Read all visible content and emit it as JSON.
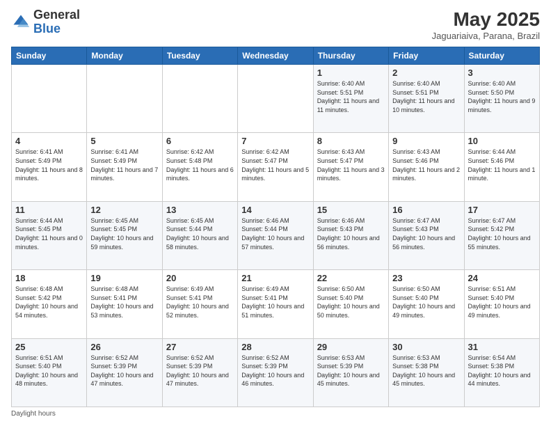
{
  "header": {
    "logo_general": "General",
    "logo_blue": "Blue",
    "month_title": "May 2025",
    "subtitle": "Jaguariaiva, Parana, Brazil"
  },
  "days_of_week": [
    "Sunday",
    "Monday",
    "Tuesday",
    "Wednesday",
    "Thursday",
    "Friday",
    "Saturday"
  ],
  "weeks": [
    [
      {
        "day": "",
        "info": ""
      },
      {
        "day": "",
        "info": ""
      },
      {
        "day": "",
        "info": ""
      },
      {
        "day": "",
        "info": ""
      },
      {
        "day": "1",
        "info": "Sunrise: 6:40 AM\nSunset: 5:51 PM\nDaylight: 11 hours and 11 minutes."
      },
      {
        "day": "2",
        "info": "Sunrise: 6:40 AM\nSunset: 5:51 PM\nDaylight: 11 hours and 10 minutes."
      },
      {
        "day": "3",
        "info": "Sunrise: 6:40 AM\nSunset: 5:50 PM\nDaylight: 11 hours and 9 minutes."
      }
    ],
    [
      {
        "day": "4",
        "info": "Sunrise: 6:41 AM\nSunset: 5:49 PM\nDaylight: 11 hours and 8 minutes."
      },
      {
        "day": "5",
        "info": "Sunrise: 6:41 AM\nSunset: 5:49 PM\nDaylight: 11 hours and 7 minutes."
      },
      {
        "day": "6",
        "info": "Sunrise: 6:42 AM\nSunset: 5:48 PM\nDaylight: 11 hours and 6 minutes."
      },
      {
        "day": "7",
        "info": "Sunrise: 6:42 AM\nSunset: 5:47 PM\nDaylight: 11 hours and 5 minutes."
      },
      {
        "day": "8",
        "info": "Sunrise: 6:43 AM\nSunset: 5:47 PM\nDaylight: 11 hours and 3 minutes."
      },
      {
        "day": "9",
        "info": "Sunrise: 6:43 AM\nSunset: 5:46 PM\nDaylight: 11 hours and 2 minutes."
      },
      {
        "day": "10",
        "info": "Sunrise: 6:44 AM\nSunset: 5:46 PM\nDaylight: 11 hours and 1 minute."
      }
    ],
    [
      {
        "day": "11",
        "info": "Sunrise: 6:44 AM\nSunset: 5:45 PM\nDaylight: 11 hours and 0 minutes."
      },
      {
        "day": "12",
        "info": "Sunrise: 6:45 AM\nSunset: 5:45 PM\nDaylight: 10 hours and 59 minutes."
      },
      {
        "day": "13",
        "info": "Sunrise: 6:45 AM\nSunset: 5:44 PM\nDaylight: 10 hours and 58 minutes."
      },
      {
        "day": "14",
        "info": "Sunrise: 6:46 AM\nSunset: 5:44 PM\nDaylight: 10 hours and 57 minutes."
      },
      {
        "day": "15",
        "info": "Sunrise: 6:46 AM\nSunset: 5:43 PM\nDaylight: 10 hours and 56 minutes."
      },
      {
        "day": "16",
        "info": "Sunrise: 6:47 AM\nSunset: 5:43 PM\nDaylight: 10 hours and 56 minutes."
      },
      {
        "day": "17",
        "info": "Sunrise: 6:47 AM\nSunset: 5:42 PM\nDaylight: 10 hours and 55 minutes."
      }
    ],
    [
      {
        "day": "18",
        "info": "Sunrise: 6:48 AM\nSunset: 5:42 PM\nDaylight: 10 hours and 54 minutes."
      },
      {
        "day": "19",
        "info": "Sunrise: 6:48 AM\nSunset: 5:41 PM\nDaylight: 10 hours and 53 minutes."
      },
      {
        "day": "20",
        "info": "Sunrise: 6:49 AM\nSunset: 5:41 PM\nDaylight: 10 hours and 52 minutes."
      },
      {
        "day": "21",
        "info": "Sunrise: 6:49 AM\nSunset: 5:41 PM\nDaylight: 10 hours and 51 minutes."
      },
      {
        "day": "22",
        "info": "Sunrise: 6:50 AM\nSunset: 5:40 PM\nDaylight: 10 hours and 50 minutes."
      },
      {
        "day": "23",
        "info": "Sunrise: 6:50 AM\nSunset: 5:40 PM\nDaylight: 10 hours and 49 minutes."
      },
      {
        "day": "24",
        "info": "Sunrise: 6:51 AM\nSunset: 5:40 PM\nDaylight: 10 hours and 49 minutes."
      }
    ],
    [
      {
        "day": "25",
        "info": "Sunrise: 6:51 AM\nSunset: 5:40 PM\nDaylight: 10 hours and 48 minutes."
      },
      {
        "day": "26",
        "info": "Sunrise: 6:52 AM\nSunset: 5:39 PM\nDaylight: 10 hours and 47 minutes."
      },
      {
        "day": "27",
        "info": "Sunrise: 6:52 AM\nSunset: 5:39 PM\nDaylight: 10 hours and 47 minutes."
      },
      {
        "day": "28",
        "info": "Sunrise: 6:52 AM\nSunset: 5:39 PM\nDaylight: 10 hours and 46 minutes."
      },
      {
        "day": "29",
        "info": "Sunrise: 6:53 AM\nSunset: 5:39 PM\nDaylight: 10 hours and 45 minutes."
      },
      {
        "day": "30",
        "info": "Sunrise: 6:53 AM\nSunset: 5:38 PM\nDaylight: 10 hours and 45 minutes."
      },
      {
        "day": "31",
        "info": "Sunrise: 6:54 AM\nSunset: 5:38 PM\nDaylight: 10 hours and 44 minutes."
      }
    ]
  ],
  "footer": {
    "note": "Daylight hours"
  }
}
